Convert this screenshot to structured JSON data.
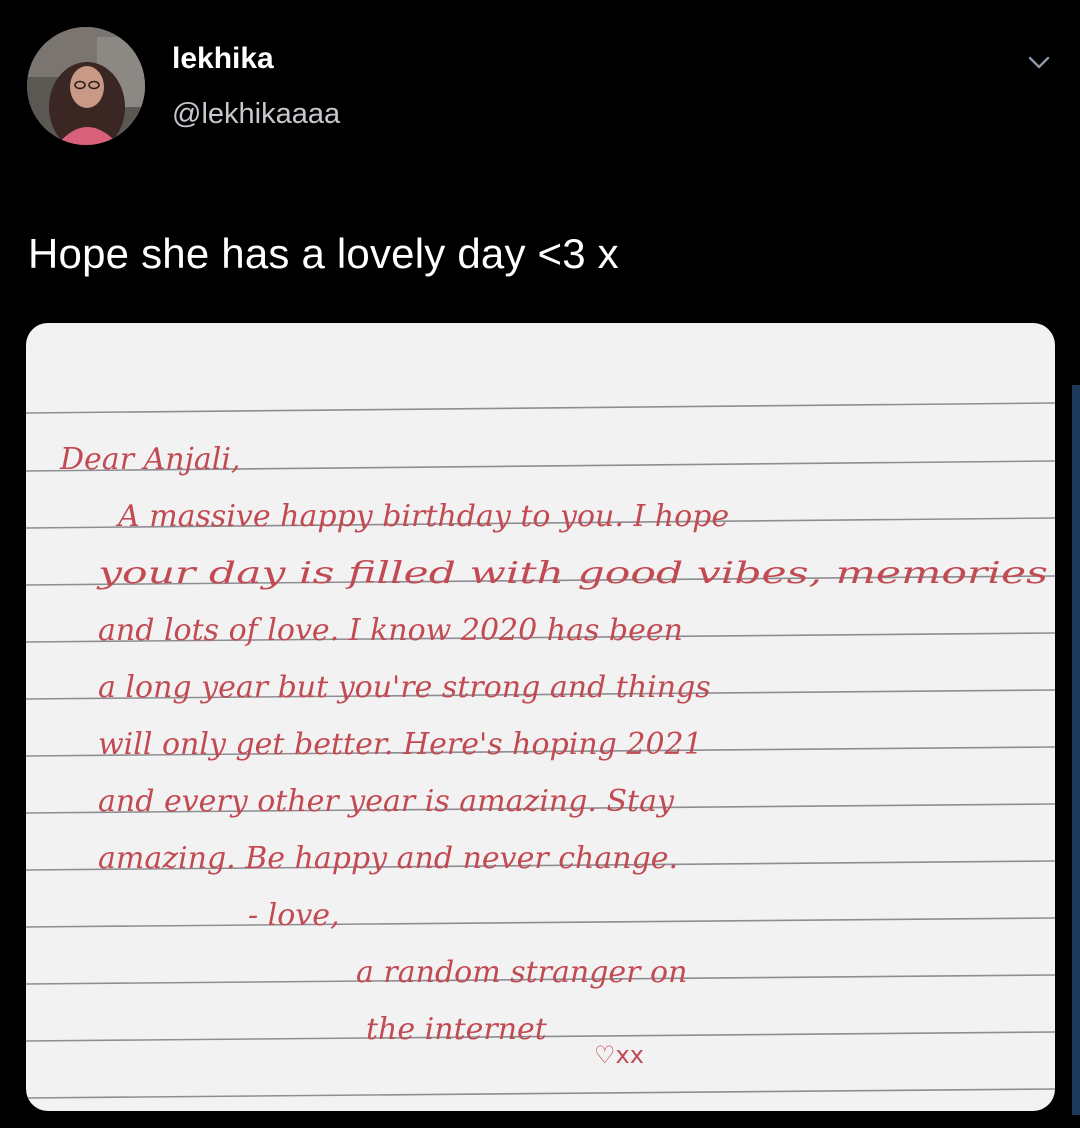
{
  "user": {
    "display_name": "lekhika",
    "handle": "@lekhikaaaa",
    "avatar_icon": "profile-photo"
  },
  "menu": {
    "icon": "chevron-down-icon"
  },
  "tweet": {
    "text": "Hope she has a lovely day <3 x"
  },
  "media": {
    "letter_lines": [
      "Dear Anjali,",
      "A massive happy birthday to you. I hope",
      "your day is filled with good vibes, memories",
      "and lots of love. I know 2020 has been",
      "a long year but you're strong and things",
      "will only get better. Here's hoping 2021",
      "and every other year is amazing. Stay",
      "amazing. Be happy and never change.",
      "- love,",
      "a random stranger on",
      "the internet"
    ],
    "signoff": "♡xx",
    "ink_color": "#c24a52"
  },
  "colors": {
    "background": "#000000",
    "text_primary": "#ffffff",
    "text_secondary": "#c5c8cc",
    "paper": "#f3f2f3",
    "ruled_line": "#8e8d92"
  }
}
